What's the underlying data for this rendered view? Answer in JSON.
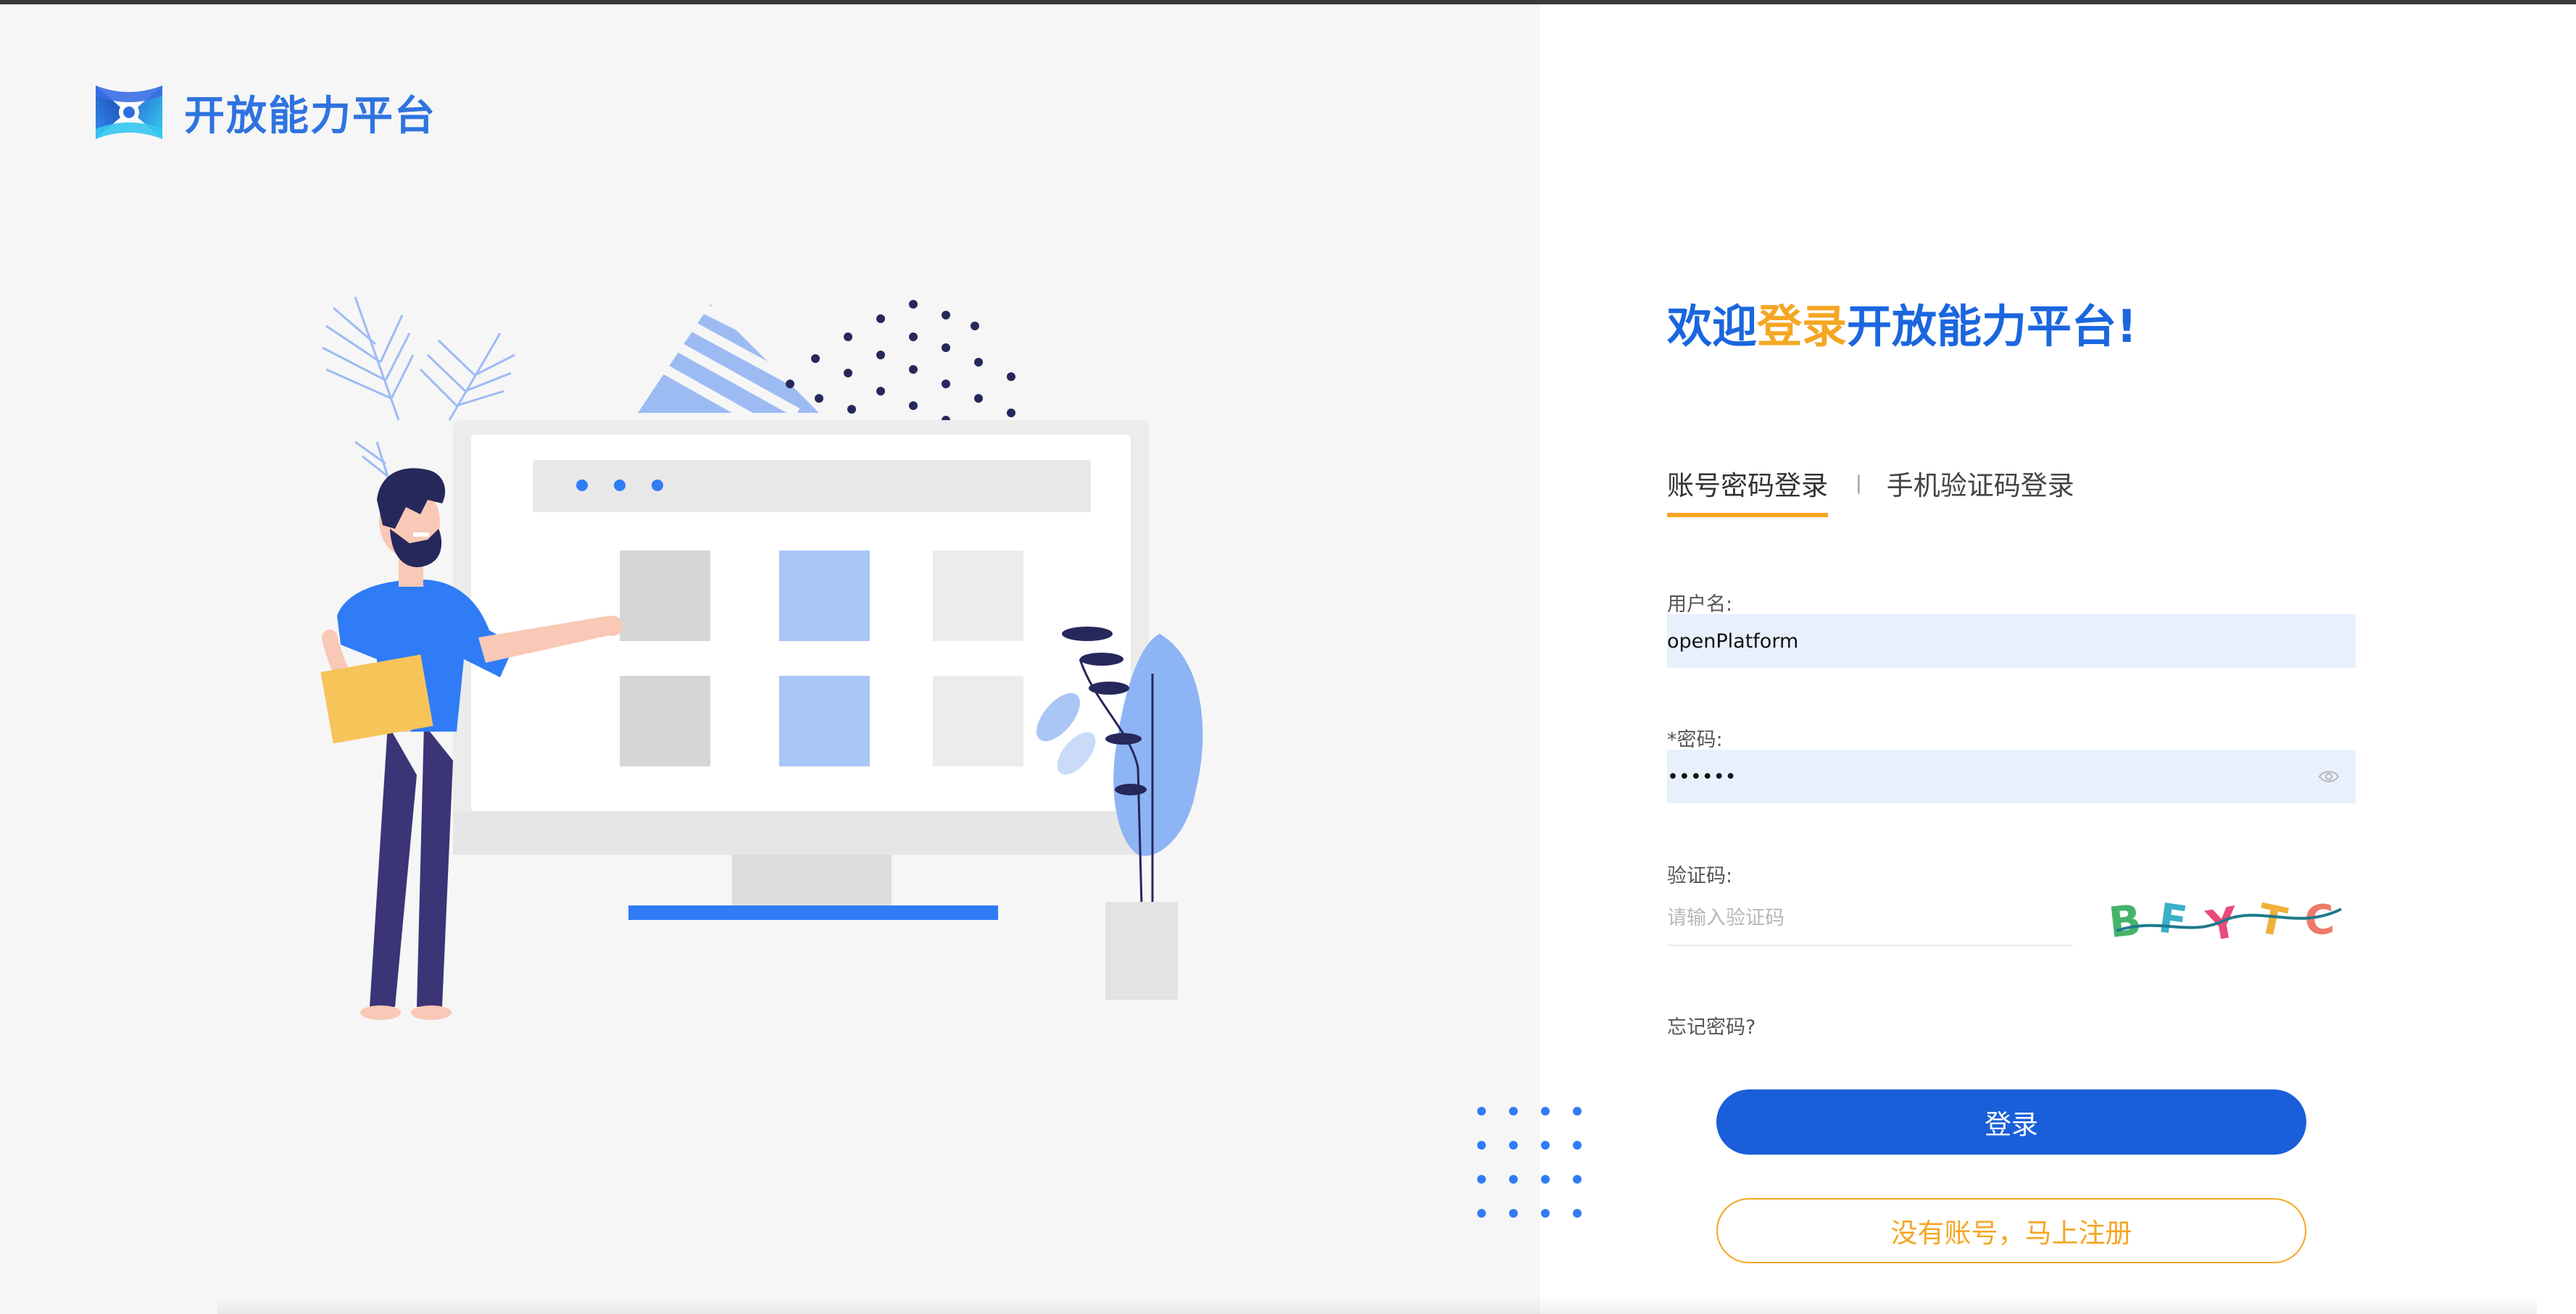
{
  "brand": {
    "name": "开放能力平台",
    "color": "#2f73e0"
  },
  "login": {
    "welcome_prefix": "欢迎",
    "welcome_highlight": "登录",
    "welcome_suffix": "开放能力平台!",
    "tabs": [
      {
        "label": "账号密码登录",
        "active": true
      },
      {
        "label": "手机验证码登录",
        "active": false
      }
    ],
    "tab_separator": "|",
    "username": {
      "label": "用户名:",
      "value": "openPlatform"
    },
    "password": {
      "label": "*密码:",
      "value": "••••••"
    },
    "captcha": {
      "label": "验证码:",
      "placeholder": "请输入验证码",
      "code": "BFYTC"
    },
    "forgot_label": "忘记密码?",
    "submit_label": "登录",
    "register_label": "没有账号，马上注册"
  },
  "colors": {
    "primary": "#1a5fd9",
    "accent": "#f5a623",
    "input_bg": "#e8f0fe",
    "illustration_navy": "#26285b",
    "illustration_blue": "#2f7cf6"
  },
  "icons": {
    "logo": "brand-logo-icon",
    "password_toggle": "eye-icon"
  }
}
